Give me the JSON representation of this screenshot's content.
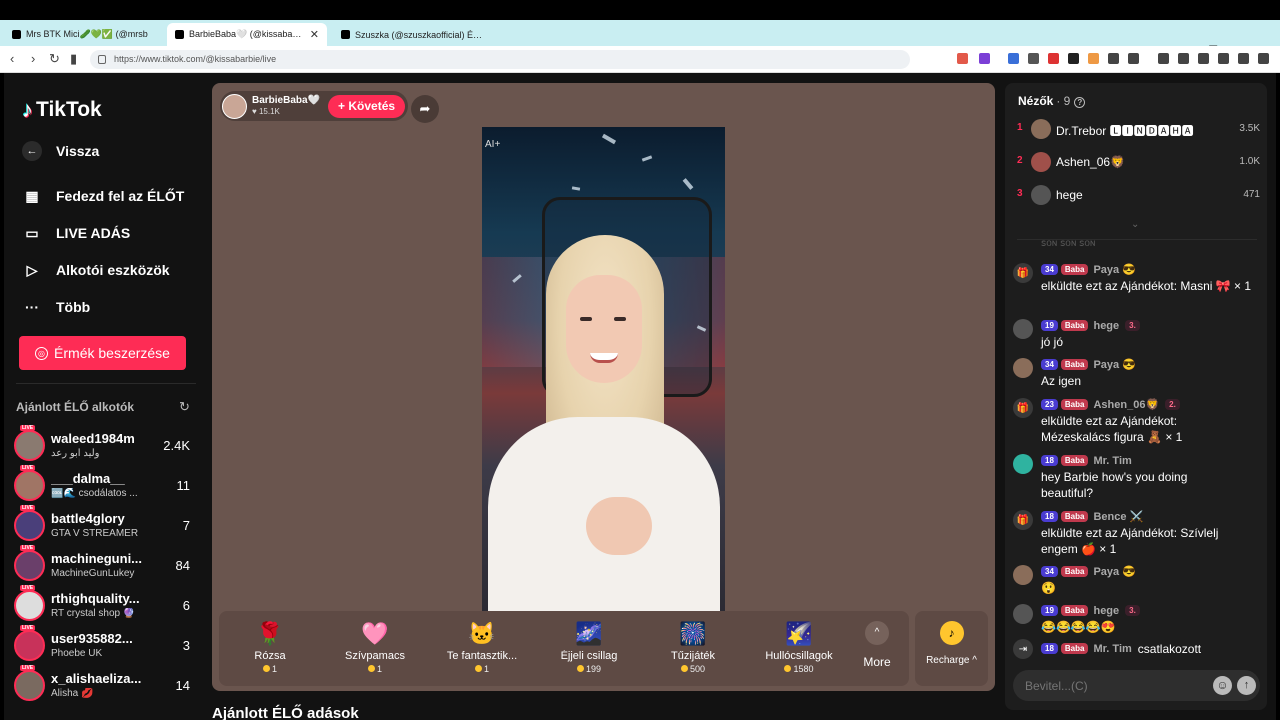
{
  "browser": {
    "tabs": [
      {
        "title": "Mrs BTK Mici🥒💚✅ (@mrsb"
      },
      {
        "title": "BarbieBaba🤍 (@kissabarbie"
      },
      {
        "title": "Szuszka (@szuszkaofficial) ÉLŐ adás"
      }
    ],
    "url": "https://www.tiktok.com/@kissabarbie/live"
  },
  "sidebar": {
    "logo": "TikTok",
    "back_label": "Vissza",
    "nav": [
      {
        "label": "Fedezd fel az ÉLŐT",
        "icon": "calendar-icon"
      },
      {
        "label": "LIVE ADÁS",
        "icon": "video-camera-icon"
      },
      {
        "label": "Alkotói eszközök",
        "icon": "creator-tools-icon"
      },
      {
        "label": "Több",
        "icon": "more-dots-icon"
      }
    ],
    "coins_button": "Érmék beszerzése",
    "recommended_title": "Ajánlott ÉLŐ alkotók",
    "live_badge": "LIVE",
    "creators": [
      {
        "name": "waleed1984m",
        "sub": "وليد ابو رعد",
        "count": "2.4K"
      },
      {
        "name": "___dalma__",
        "sub": "🆒🌊 csodálatos ...",
        "count": "11"
      },
      {
        "name": "battle4glory",
        "sub": "GTA V STREAMER",
        "count": "7"
      },
      {
        "name": "machineguni...",
        "sub": "MachineGunLukey",
        "count": "84"
      },
      {
        "name": "rthighquality...",
        "sub": "RT crystal shop 🔮",
        "count": "6"
      },
      {
        "name": "user935882...",
        "sub": "Phoebe UK",
        "count": "3"
      },
      {
        "name": "x_alishaeliza...",
        "sub": "Alisha 💋",
        "count": "14"
      }
    ]
  },
  "stage": {
    "host_name": "BarbieBaba🤍",
    "host_likes": "♥ 15.1K",
    "follow_label": "+ Követés",
    "video_tag": "AI+",
    "gifts": [
      {
        "name": "Rózsa",
        "price": "1",
        "icon": "🌹"
      },
      {
        "name": "Szívpamacs",
        "price": "1",
        "icon": "🩷"
      },
      {
        "name": "Te fantasztik...",
        "price": "1",
        "icon": "🐱"
      },
      {
        "name": "Éjjeli csillag",
        "price": "199",
        "icon": "🌌"
      },
      {
        "name": "Tűzijáték",
        "price": "500",
        "icon": "🎆"
      },
      {
        "name": "Hullócsillagok",
        "price": "1580",
        "icon": "🌠"
      }
    ],
    "more_label": "More",
    "recharge_label": "Recharge ^"
  },
  "bottom_title": "Ajánlott ÉLŐ adások",
  "chat": {
    "viewers_label": "Nézők",
    "viewers_count": "· 9",
    "top_viewers": [
      {
        "rank": "1",
        "name": "Dr.Trebor 🅻🅸🅽🅳🅰🅷🅰",
        "score": "3.5K"
      },
      {
        "rank": "2",
        "name": "Ashen_06🦁",
        "score": "1.0K"
      },
      {
        "rank": "3",
        "name": "hege",
        "score": "471"
      }
    ],
    "faded_line": "ꜱᴏɴ ꜱᴏɴ ꜱᴏɴ",
    "messages": [
      {
        "icon": "gift-icon",
        "level": "34",
        "fan": "Baba",
        "user": "Paya 😎",
        "rank": "",
        "text": "elküldte ezt az Ajándékot: Masni 🎀 × 1"
      },
      {
        "icon": "avatar",
        "level": "19",
        "fan": "Baba",
        "user": "hege",
        "rank": "3.",
        "text": "jó jó"
      },
      {
        "icon": "avatar",
        "level": "34",
        "fan": "Baba",
        "user": "Paya 😎",
        "rank": "",
        "text": "Az igen"
      },
      {
        "icon": "gift-icon",
        "level": "23",
        "fan": "Baba",
        "user": "Ashen_06🦁",
        "rank": "2.",
        "text": "elküldte ezt az Ajándékot: Mézeskalács figura 🧸 × 1"
      },
      {
        "icon": "avatar",
        "level": "18",
        "fan": "Baba",
        "user": "Mr. Tim",
        "rank": "",
        "text": "hey Barbie how's you doing beautiful?"
      },
      {
        "icon": "gift-icon",
        "level": "18",
        "fan": "Baba",
        "user": "Bence ⚔️",
        "rank": "",
        "text": "elküldte ezt az Ajándékot: Szívlelj engem 🍎 × 1"
      },
      {
        "icon": "avatar",
        "level": "34",
        "fan": "Baba",
        "user": "Paya 😎",
        "rank": "",
        "text": "😲"
      },
      {
        "icon": "avatar",
        "level": "19",
        "fan": "Baba",
        "user": "hege",
        "rank": "3.",
        "text": "😂😂😂😂😍"
      },
      {
        "icon": "join-icon",
        "level": "18",
        "fan": "Baba",
        "user": "Mr. Tim",
        "rank": "",
        "text": "csatlakozott"
      }
    ],
    "input_placeholder": "Bevitel...(C)"
  }
}
